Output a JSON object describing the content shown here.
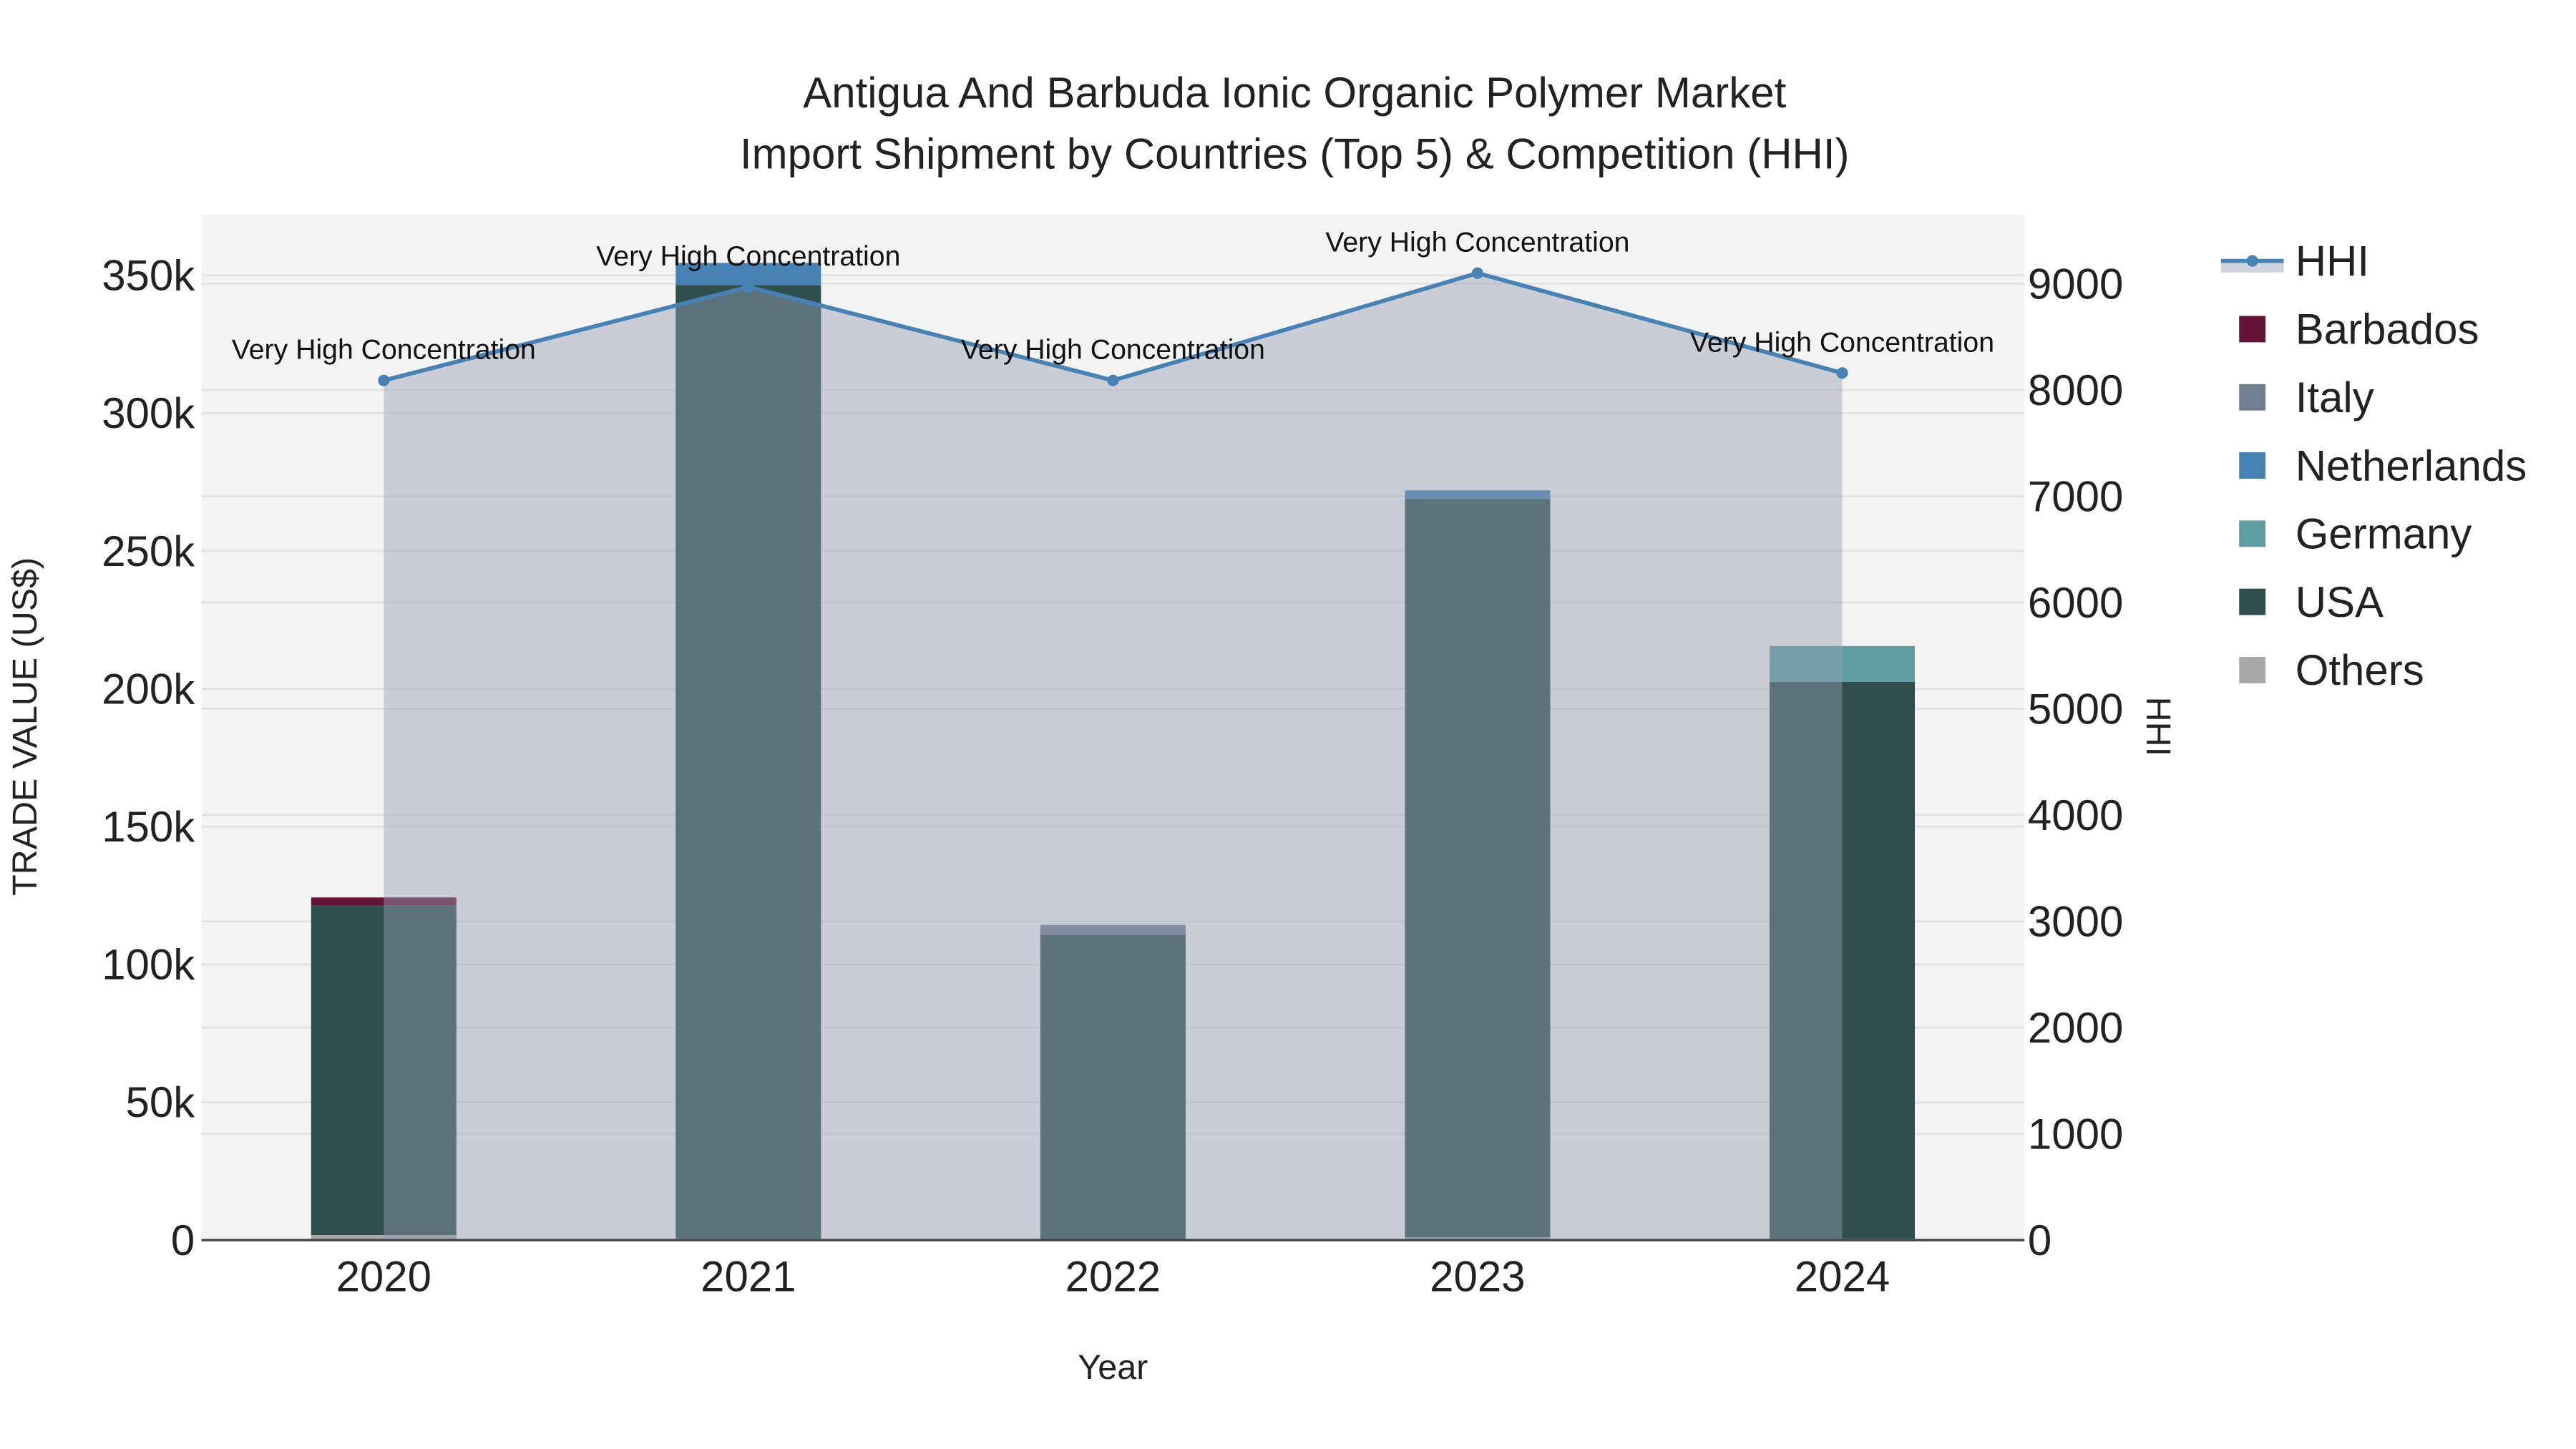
{
  "chart_data": {
    "type": "bar",
    "title_lines": [
      "Antigua And Barbuda Ionic Organic Polymer Market",
      "Import Shipment by Countries (Top 5) & Competition (HHI)"
    ],
    "xlabel": "Year",
    "ylabel": "TRADE VALUE (US$)",
    "y2label": "HHI",
    "categories": [
      "2020",
      "2021",
      "2022",
      "2023",
      "2024"
    ],
    "ylim": [
      0,
      372000
    ],
    "y_ticks": [
      0,
      50000,
      100000,
      150000,
      200000,
      250000,
      300000,
      350000
    ],
    "y_tick_labels": [
      "0",
      "50k",
      "100k",
      "150k",
      "200k",
      "250k",
      "300k",
      "350k"
    ],
    "y2lim": [
      0,
      9650
    ],
    "y2_ticks": [
      0,
      1000,
      2000,
      3000,
      4000,
      5000,
      6000,
      7000,
      8000,
      9000
    ],
    "y2_tick_labels": [
      "0",
      "1000",
      "2000",
      "3000",
      "4000",
      "5000",
      "6000",
      "7000",
      "8000",
      "9000"
    ],
    "grid": true,
    "legend_position": "right",
    "stack_order": [
      "Others",
      "USA",
      "Germany",
      "Netherlands",
      "Italy",
      "Barbados"
    ],
    "series": [
      {
        "name": "Barbados",
        "color": "#641537",
        "values": [
          3000,
          0,
          0,
          0,
          0
        ]
      },
      {
        "name": "Italy",
        "color": "#708090",
        "values": [
          0,
          0,
          3500,
          0,
          0
        ]
      },
      {
        "name": "Netherlands",
        "color": "#4682b4",
        "values": [
          0,
          8000,
          0,
          3000,
          0
        ]
      },
      {
        "name": "Germany",
        "color": "#5f9ea0",
        "values": [
          0,
          0,
          0,
          0,
          13000
        ]
      },
      {
        "name": "USA",
        "color": "#2f4f4f",
        "values": [
          119500,
          346000,
          110500,
          268000,
          202000
        ]
      },
      {
        "name": "Others",
        "color": "#a9a9a9",
        "values": [
          1800,
          500,
          300,
          1000,
          500
        ]
      }
    ],
    "hhi": {
      "name": "HHI",
      "color": "#4682b4",
      "values": [
        8090,
        8970,
        8090,
        9100,
        8160
      ],
      "annotations": [
        "Very High Concentration",
        "Very High Concentration",
        "Very High Concentration",
        "Very High Concentration",
        "Very High Concentration"
      ]
    },
    "legend": [
      "HHI",
      "Barbados",
      "Italy",
      "Netherlands",
      "Germany",
      "USA",
      "Others"
    ]
  }
}
